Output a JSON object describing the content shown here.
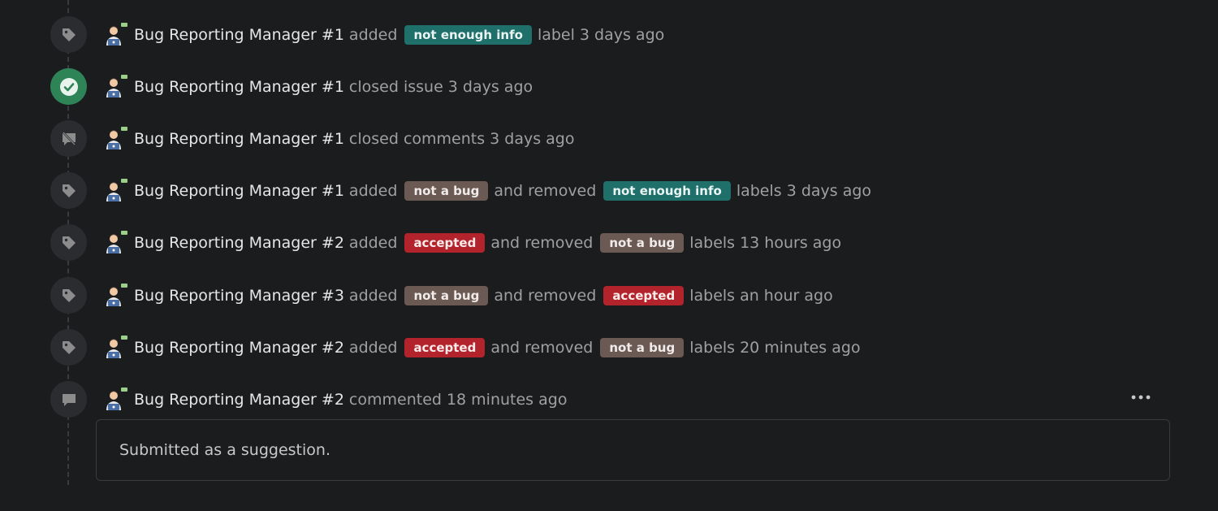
{
  "colors": {
    "background": "#1b1c1e",
    "icon_bg": "#2b2c2f",
    "closed_bg": "#2e8457",
    "label_teal": "#1f6f6b",
    "label_brown": "#6b5a53",
    "label_red": "#b3232b"
  },
  "labels": {
    "not_enough_info": {
      "text": "not enough info",
      "color": "#1f6f6b"
    },
    "not_a_bug": {
      "text": "not a bug",
      "color": "#6b5a53"
    },
    "accepted": {
      "text": "accepted",
      "color": "#b3232b"
    }
  },
  "events": [
    {
      "icon": "tag-icon",
      "author": "Bug Reporting Manager #1",
      "parts": [
        "added",
        "not enough info",
        "label",
        "3 days ago"
      ]
    },
    {
      "icon": "check-circle-icon",
      "author": "Bug Reporting Manager #1",
      "parts": [
        "closed issue",
        "3 days ago"
      ]
    },
    {
      "icon": "comment-slash-icon",
      "author": "Bug Reporting Manager #1",
      "parts": [
        "closed comments",
        "3 days ago"
      ]
    },
    {
      "icon": "tag-icon",
      "author": "Bug Reporting Manager #1",
      "parts": [
        "added",
        "not a bug",
        "and removed",
        "not enough info",
        "labels",
        "3 days ago"
      ]
    },
    {
      "icon": "tag-icon",
      "author": "Bug Reporting Manager #2",
      "parts": [
        "added",
        "accepted",
        "and removed",
        "not a bug",
        "labels",
        "13 hours ago"
      ]
    },
    {
      "icon": "tag-icon",
      "author": "Bug Reporting Manager #3",
      "parts": [
        "added",
        "not a bug",
        "and removed",
        "accepted",
        "labels",
        "an hour ago"
      ]
    },
    {
      "icon": "tag-icon",
      "author": "Bug Reporting Manager #2",
      "parts": [
        "added",
        "accepted",
        "and removed",
        "not a bug",
        "labels",
        "20 minutes ago"
      ]
    },
    {
      "icon": "comment-icon",
      "author": "Bug Reporting Manager #2",
      "parts": [
        "commented",
        "18 minutes ago"
      ]
    }
  ],
  "comment": {
    "body": "Submitted as a suggestion."
  }
}
